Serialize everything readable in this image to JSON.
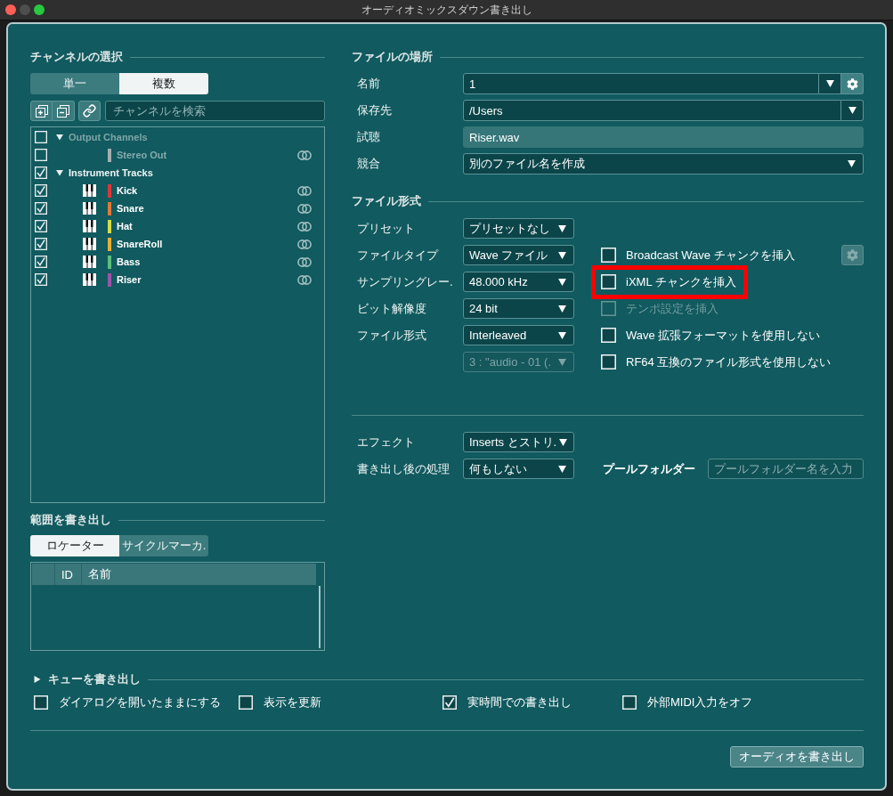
{
  "window": {
    "title": "オーディオミックスダウン書き出し",
    "controls": [
      {
        "kind": "close",
        "disabled": false
      },
      {
        "kind": "minimize",
        "disabled": true
      },
      {
        "kind": "zoom",
        "disabled": false
      }
    ]
  },
  "channel_selection": {
    "heading": "チャンネルの選択",
    "modes": [
      {
        "label": "単一",
        "selected": false
      },
      {
        "label": "複数",
        "selected": true
      }
    ],
    "search": {
      "placeholder": "チャンネルを検索"
    },
    "groups": [
      {
        "label": "Output Channels",
        "checked": false,
        "disabled": true,
        "expanded": true,
        "children": [
          {
            "kind": "output",
            "name": "Stereo Out",
            "checked": false,
            "disabled": true,
            "color": "#a3afaf"
          }
        ]
      },
      {
        "label": "Instrument Tracks",
        "checked": true,
        "disabled": false,
        "expanded": true,
        "children": [
          {
            "kind": "instrument",
            "name": "Kick",
            "checked": true,
            "disabled": false,
            "color": "#d9383a"
          },
          {
            "kind": "instrument",
            "name": "Snare",
            "checked": true,
            "disabled": false,
            "color": "#e07a35"
          },
          {
            "kind": "instrument",
            "name": "Hat",
            "checked": true,
            "disabled": false,
            "color": "#d4dc48"
          },
          {
            "kind": "instrument",
            "name": "SnareRoll",
            "checked": true,
            "disabled": false,
            "color": "#e6b034"
          },
          {
            "kind": "instrument",
            "name": "Bass",
            "checked": true,
            "disabled": false,
            "color": "#5cbf7e"
          },
          {
            "kind": "instrument",
            "name": "Riser",
            "checked": true,
            "disabled": false,
            "color": "#9a55a8"
          }
        ]
      }
    ]
  },
  "export_range": {
    "heading": "範囲を書き出し",
    "modes": [
      {
        "label": "ロケーター",
        "selected": true
      },
      {
        "label": "サイクルマーカ.",
        "selected": false
      }
    ],
    "table": {
      "columns": [
        "ID",
        "名前"
      ]
    }
  },
  "file_location": {
    "heading": "ファイルの場所",
    "fields": [
      {
        "kind": "combo",
        "label": "名前",
        "value": "1"
      },
      {
        "kind": "path",
        "label": "保存先",
        "value": "/Users"
      },
      {
        "kind": "readonly",
        "label": "試聴",
        "value": "Riser.wav"
      },
      {
        "kind": "dropdown",
        "label": "競合",
        "value": "別のファイル名を作成"
      }
    ]
  },
  "file_format": {
    "heading": "ファイル形式",
    "rows": [
      {
        "label": "プリセット",
        "dropdown": {
          "value": "プリセットなし",
          "disabled": false
        }
      },
      {
        "label": "ファイルタイプ",
        "dropdown": {
          "value": "Wave ファイル",
          "disabled": false
        },
        "option": {
          "label": "Broadcast Wave チャンクを挿入",
          "checked": false,
          "disabled": false,
          "highlighted": false,
          "settings_button": {
            "disabled": true
          }
        }
      },
      {
        "label": "サンプリングレー.",
        "dropdown": {
          "value": "48.000 kHz",
          "disabled": false
        },
        "option": {
          "label": "iXML チャンクを挿入",
          "checked": false,
          "disabled": false,
          "highlighted": true
        }
      },
      {
        "label": "ビット解像度",
        "dropdown": {
          "value": "24 bit",
          "disabled": false
        },
        "option": {
          "label": "テンポ設定を挿入",
          "checked": false,
          "disabled": true,
          "highlighted": false
        }
      },
      {
        "label": "ファイル形式",
        "dropdown": {
          "value": "Interleaved",
          "disabled": false
        },
        "option": {
          "label": "Wave 拡張フォーマットを使用しない",
          "checked": false,
          "disabled": false,
          "highlighted": false
        }
      },
      {
        "dropdown": {
          "value": "3 : \"audio - 01 (.",
          "disabled": true
        },
        "option": {
          "label": "RF64 互換のファイル形式を使用しない",
          "checked": false,
          "disabled": false,
          "highlighted": false
        }
      }
    ]
  },
  "processing": {
    "rows": [
      {
        "label": "エフェクト",
        "value": "Inserts とストリ."
      },
      {
        "label": "書き出し後の処理",
        "value": "何もしない"
      }
    ],
    "pool_folder": {
      "label": "プールフォルダー",
      "placeholder": "プールフォルダー名を入力"
    }
  },
  "queue": {
    "heading": "キューを書き出し",
    "expanded": false,
    "options": [
      {
        "label": "ダイアログを開いたままにする",
        "checked": false
      },
      {
        "label": "表示を更新",
        "checked": false
      },
      {
        "label": "実時間での書き出し",
        "checked": true
      },
      {
        "label": "外部MIDI入力をオフ",
        "checked": false
      }
    ]
  },
  "export_button": {
    "label": "オーディオを書き出し"
  }
}
